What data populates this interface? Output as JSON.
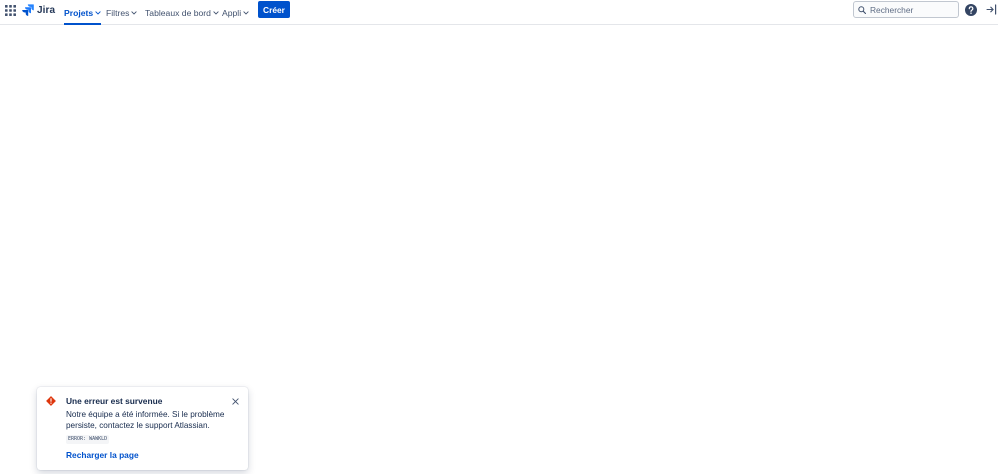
{
  "header": {
    "logo_text": "Jira",
    "nav": [
      {
        "label": "Projets",
        "active": true
      },
      {
        "label": "Filtres",
        "active": false
      },
      {
        "label": "Tableaux de bord",
        "active": false
      },
      {
        "label": "Appli",
        "active": false
      }
    ],
    "create_label": "Créer",
    "search": {
      "placeholder": "Rechercher",
      "value": ""
    },
    "icons": [
      "app-switcher-icon",
      "jira-logo-icon",
      "search-icon",
      "help-icon",
      "sign-in-icon"
    ]
  },
  "error_flag": {
    "title": "Une erreur est survenue",
    "body": "Notre équipe a été informée. Si le problème persiste, contactez le support Atlassian.",
    "code": "ERROR: WAWKLD",
    "action_label": "Recharger la page",
    "icon": "error-icon"
  },
  "colors": {
    "brand": "#0052cc",
    "text": "#172b4d",
    "nav_text": "#42526e",
    "error": "#de350b"
  }
}
